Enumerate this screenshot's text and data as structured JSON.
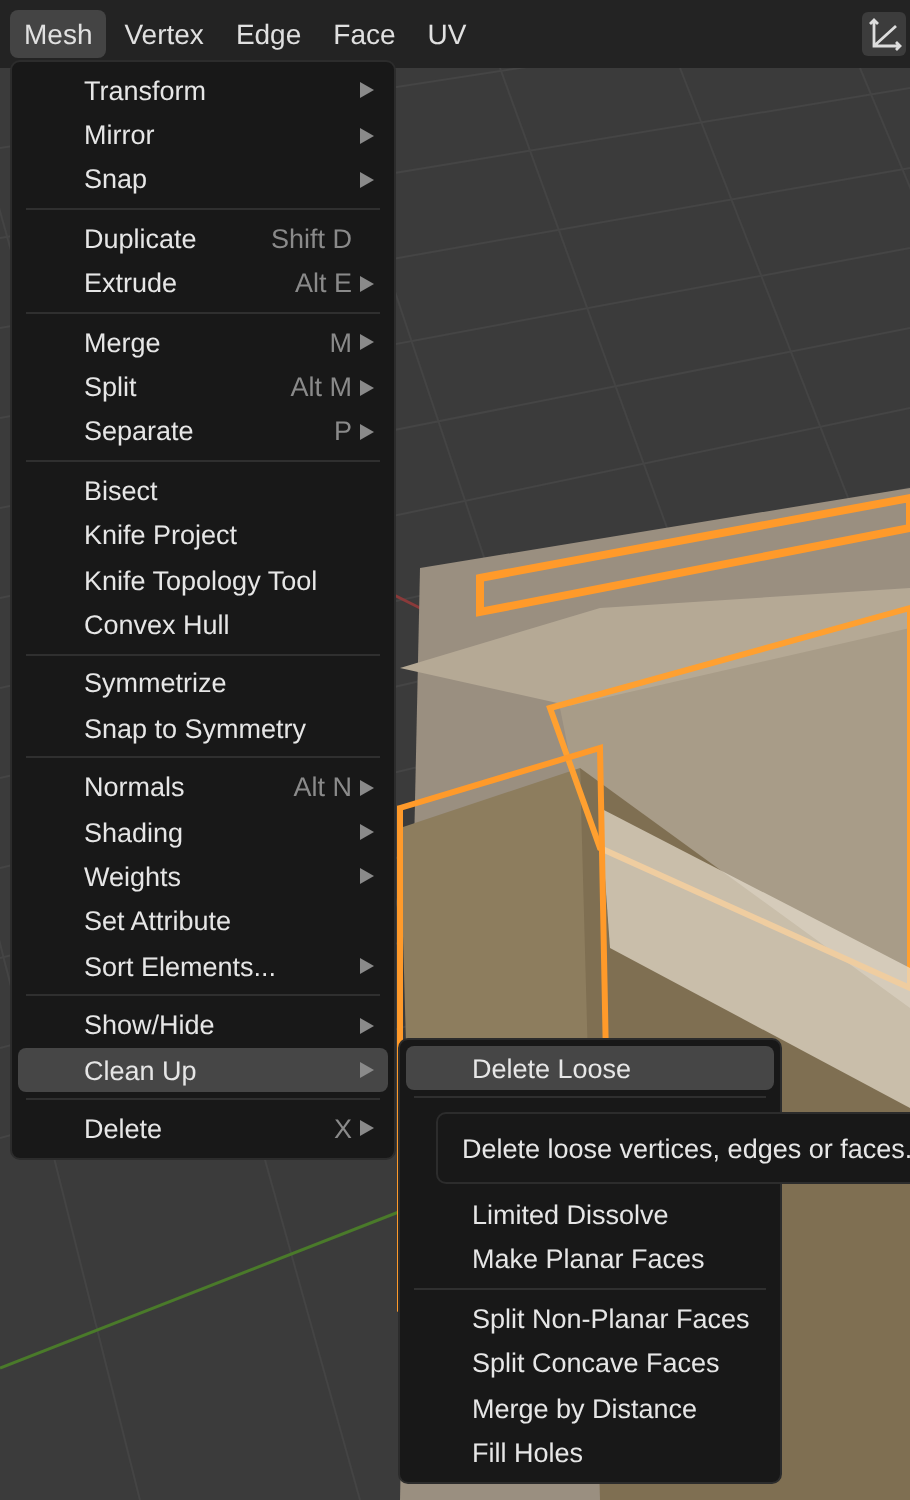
{
  "menubar": {
    "items": [
      {
        "label": "Mesh",
        "selected": true
      },
      {
        "label": "Vertex",
        "selected": false
      },
      {
        "label": "Edge",
        "selected": false
      },
      {
        "label": "Face",
        "selected": false
      },
      {
        "label": "UV",
        "selected": false
      }
    ]
  },
  "mesh_menu": {
    "groups": [
      [
        {
          "label": "Transform",
          "has_submenu": true,
          "selected": false
        },
        {
          "label": "Mirror",
          "has_submenu": true,
          "selected": false
        },
        {
          "label": "Snap",
          "has_submenu": true,
          "selected": false
        }
      ],
      [
        {
          "label": "Duplicate",
          "shortcut": "Shift D",
          "has_submenu": false,
          "selected": false
        },
        {
          "label": "Extrude",
          "shortcut": "Alt E",
          "has_submenu": true,
          "selected": false
        }
      ],
      [
        {
          "label": "Merge",
          "shortcut": "M",
          "has_submenu": true,
          "selected": false
        },
        {
          "label": "Split",
          "shortcut": "Alt M",
          "has_submenu": true,
          "selected": false
        },
        {
          "label": "Separate",
          "shortcut": "P",
          "has_submenu": true,
          "selected": false
        }
      ],
      [
        {
          "label": "Bisect",
          "has_submenu": false,
          "selected": false
        },
        {
          "label": "Knife Project",
          "has_submenu": false,
          "selected": false
        },
        {
          "label": "Knife Topology Tool",
          "has_submenu": false,
          "selected": false
        },
        {
          "label": "Convex Hull",
          "has_submenu": false,
          "selected": false
        }
      ],
      [
        {
          "label": "Symmetrize",
          "has_submenu": false,
          "selected": false
        },
        {
          "label": "Snap to Symmetry",
          "has_submenu": false,
          "selected": false
        }
      ],
      [
        {
          "label": "Normals",
          "shortcut": "Alt N",
          "has_submenu": true,
          "selected": false
        },
        {
          "label": "Shading",
          "has_submenu": true,
          "selected": false
        },
        {
          "label": "Weights",
          "has_submenu": true,
          "selected": false
        },
        {
          "label": "Set Attribute",
          "has_submenu": false,
          "selected": false
        },
        {
          "label": "Sort Elements...",
          "has_submenu": true,
          "selected": false
        }
      ],
      [
        {
          "label": "Show/Hide",
          "has_submenu": true,
          "selected": false
        },
        {
          "label": "Clean Up",
          "has_submenu": true,
          "selected": true
        }
      ],
      [
        {
          "label": "Delete",
          "shortcut": "X",
          "has_submenu": true,
          "selected": false
        }
      ]
    ]
  },
  "clean_up_menu": {
    "groups": [
      [
        {
          "label": "Delete Loose",
          "selected": true
        }
      ],
      [
        {
          "label": "Limited Dissolve",
          "selected": false
        },
        {
          "label": "Make Planar Faces",
          "selected": false
        }
      ],
      [
        {
          "label": "Split Non-Planar Faces",
          "selected": false
        },
        {
          "label": "Split Concave Faces",
          "selected": false
        },
        {
          "label": "Merge by Distance",
          "selected": false
        },
        {
          "label": "Fill Holes",
          "selected": false
        }
      ]
    ]
  },
  "tooltip": {
    "text": "Delete loose vertices, edges or faces."
  }
}
